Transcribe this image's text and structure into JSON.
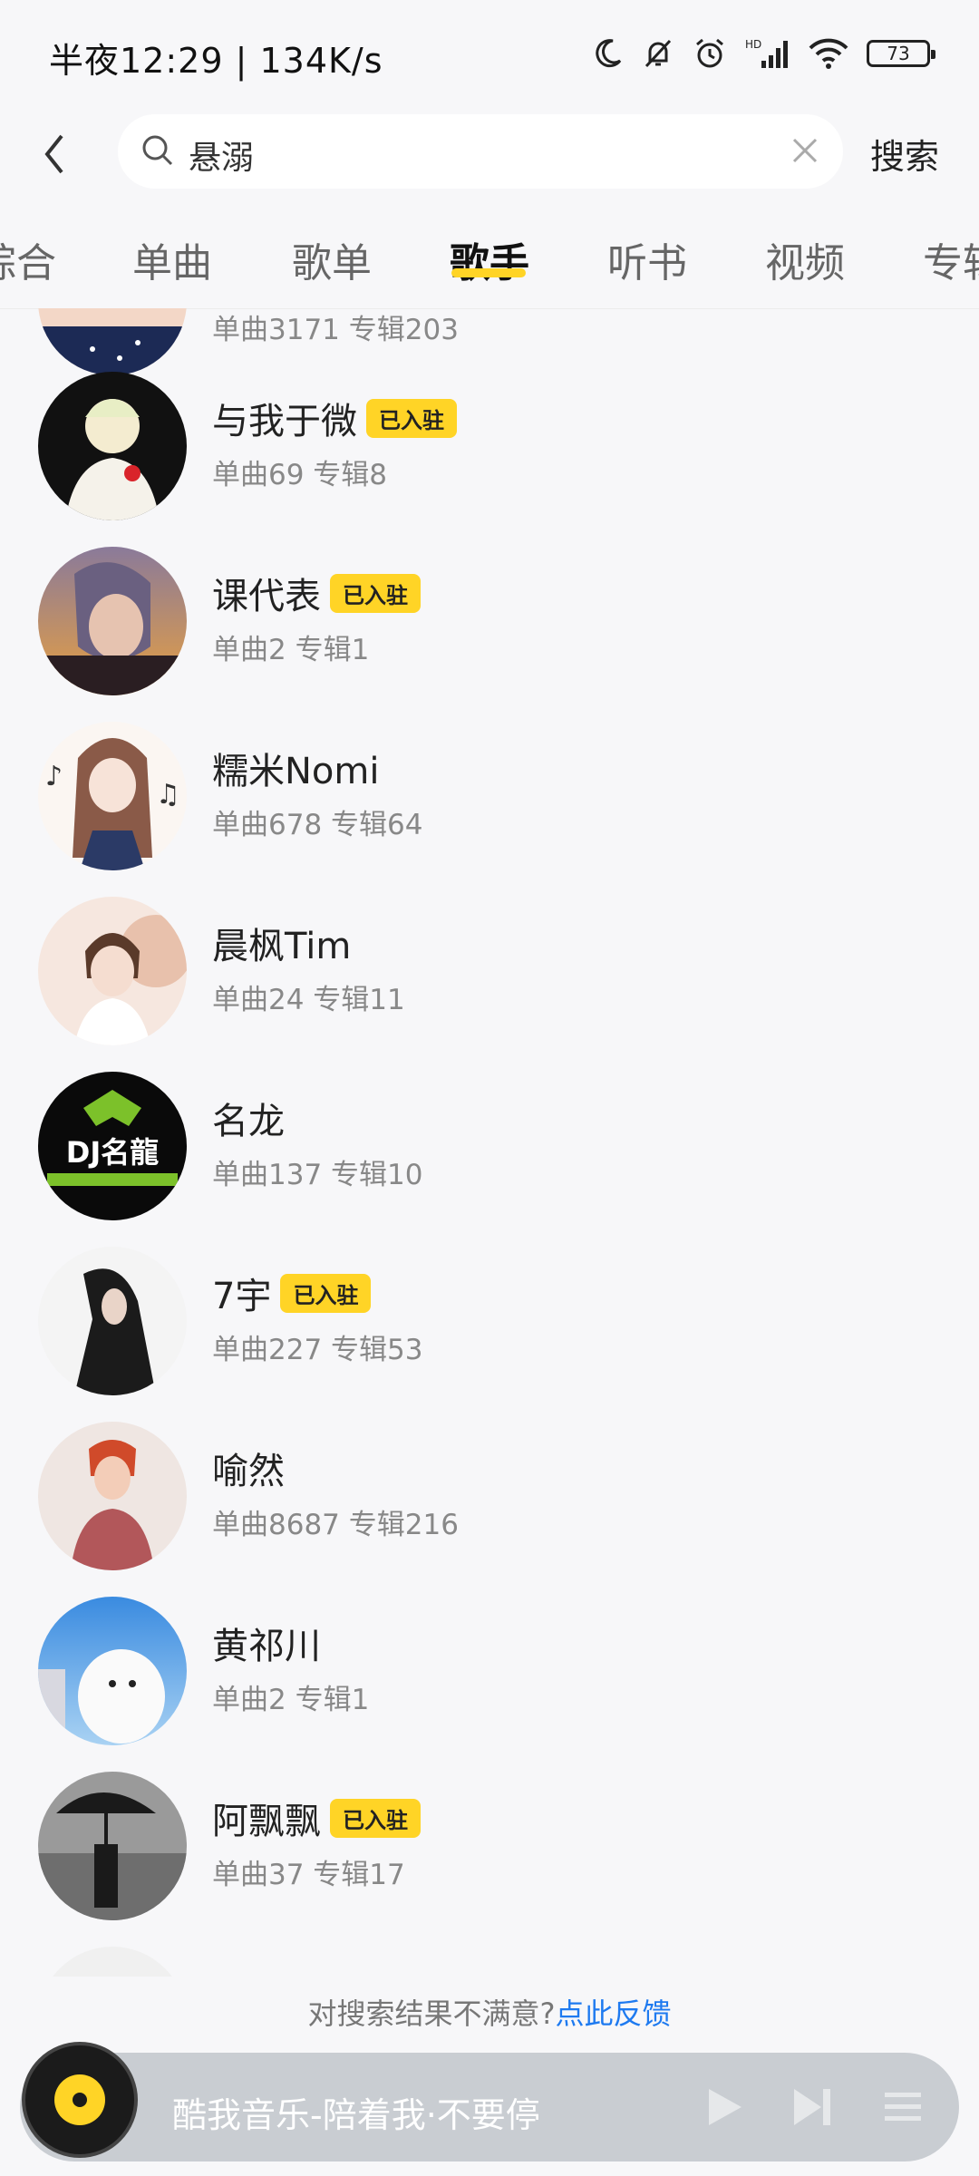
{
  "status_bar": {
    "time_text": "半夜12:29 | 134K/s",
    "battery": "73",
    "icons": [
      "moon-icon",
      "bell-off-icon",
      "alarm-icon",
      "hd-signal-icon",
      "wifi-icon",
      "battery-icon"
    ]
  },
  "search": {
    "query": "悬溺",
    "action_label": "搜索"
  },
  "tabs": [
    {
      "label": "综合",
      "active": false
    },
    {
      "label": "单曲",
      "active": false
    },
    {
      "label": "歌单",
      "active": false
    },
    {
      "label": "歌手",
      "active": true
    },
    {
      "label": "听书",
      "active": false
    },
    {
      "label": "视频",
      "active": false
    },
    {
      "label": "专辑",
      "active": false
    }
  ],
  "artists": [
    {
      "name": "",
      "meta": "单曲3171 专辑203",
      "badge": ""
    },
    {
      "name": "与我于微",
      "meta": "单曲69 专辑8",
      "badge": "已入驻"
    },
    {
      "name": "课代表",
      "meta": "单曲2 专辑1",
      "badge": "已入驻"
    },
    {
      "name": "糯米Nomi",
      "meta": "单曲678 专辑64",
      "badge": ""
    },
    {
      "name": "晨枫Tim",
      "meta": "单曲24 专辑11",
      "badge": ""
    },
    {
      "name": "名龙",
      "meta": "单曲137 专辑10",
      "badge": ""
    },
    {
      "name": "7宇",
      "meta": "单曲227 专辑53",
      "badge": "已入驻"
    },
    {
      "name": "喻然",
      "meta": "单曲8687 专辑216",
      "badge": ""
    },
    {
      "name": "黄祁川",
      "meta": "单曲2 专辑1",
      "badge": ""
    },
    {
      "name": "阿飘飘",
      "meta": "单曲37 专辑17",
      "badge": "已入驻"
    }
  ],
  "avatar_logo_text": "DJ名龍",
  "feedback": {
    "text": "对搜索结果不满意?",
    "link": "点此反馈"
  },
  "player": {
    "title": "酷我音乐-陪着我·不要停"
  },
  "colors": {
    "accent": "#ffd426",
    "link": "#1e7af0",
    "background": "#f7f7f9"
  }
}
